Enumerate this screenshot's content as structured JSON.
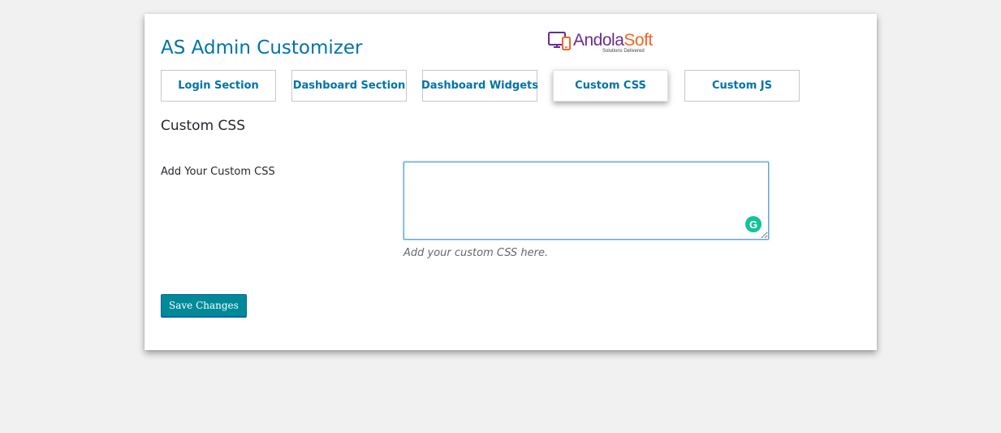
{
  "header": {
    "title": "AS Admin Customizer"
  },
  "logo": {
    "brand_part_a": "Andola",
    "brand_part_b": "Soft",
    "tagline": "Solutions Delivered",
    "colors": {
      "purple": "#6a2c91",
      "orange": "#f26522"
    }
  },
  "tabs": [
    {
      "label": "Login Section",
      "active": false
    },
    {
      "label": "Dashboard Section",
      "active": false
    },
    {
      "label": "Dashboard Widgets",
      "active": false
    },
    {
      "label": "Custom CSS",
      "active": true
    },
    {
      "label": "Custom JS",
      "active": false
    }
  ],
  "section": {
    "heading": "Custom CSS"
  },
  "form": {
    "custom_css_label": "Add Your Custom CSS",
    "custom_css_value": "",
    "custom_css_description": "Add your custom CSS here.",
    "grammarly_glyph": "G",
    "save_label": "Save Changes"
  },
  "colors": {
    "accent": "#0073aa",
    "button": "#008a99",
    "grammarly": "#15c39a",
    "background": "#f1f1f1"
  },
  "icons": {
    "logo": "devices-icon",
    "grammarly": "grammarly-icon"
  }
}
